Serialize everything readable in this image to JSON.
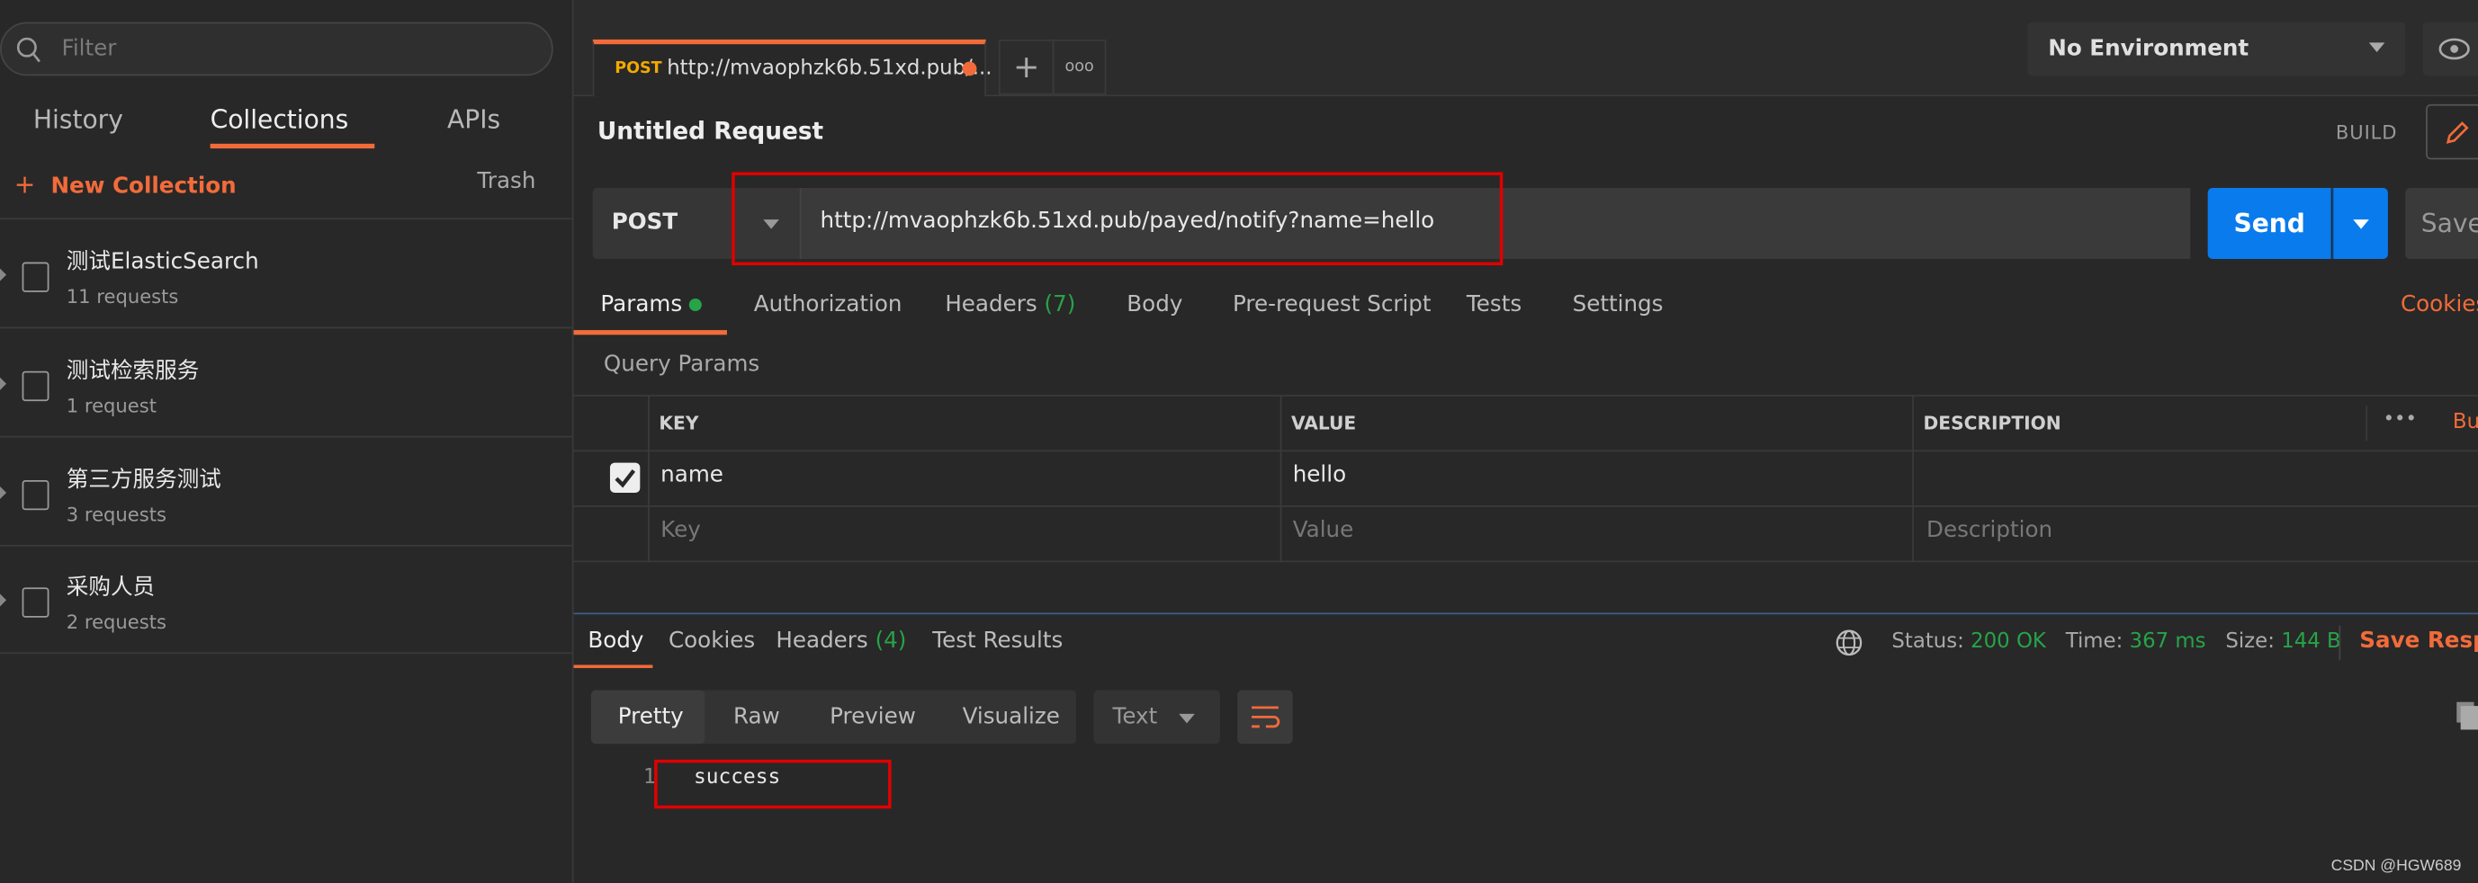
{
  "sidebar": {
    "filter_placeholder": "Filter",
    "tabs": [
      {
        "label": "History"
      },
      {
        "label": "Collections",
        "active": true
      },
      {
        "label": "APIs"
      }
    ],
    "new_collection": "New Collection",
    "trash": "Trash",
    "collections": [
      {
        "name": "测试ElasticSearch",
        "count": "11 requests"
      },
      {
        "name": "测试检索服务",
        "count": "1 request"
      },
      {
        "name": "第三方服务测试",
        "count": "3 requests"
      },
      {
        "name": "采购人员",
        "count": "2 requests"
      }
    ]
  },
  "request_tab": {
    "method": "POST",
    "title": "http://mvaophzk6b.51xd.pub/...",
    "plus": "+",
    "more": "ooo"
  },
  "environment": {
    "selected": "No Environment"
  },
  "request": {
    "title": "Untitled Request",
    "build": "BUILD",
    "method": "POST",
    "url": "http://mvaophzk6b.51xd.pub/payed/notify?name=hello",
    "send": "Send",
    "save": "Save"
  },
  "request_tabs": [
    {
      "label": "Params",
      "active": true
    },
    {
      "label": "Authorization"
    },
    {
      "label": "Headers",
      "count": "(7)"
    },
    {
      "label": "Body"
    },
    {
      "label": "Pre-request Script"
    },
    {
      "label": "Tests"
    },
    {
      "label": "Settings"
    }
  ],
  "cookies": "Cookies",
  "query_params": {
    "title": "Query Params",
    "headers": {
      "key": "KEY",
      "value": "VALUE",
      "description": "DESCRIPTION",
      "more": "•••",
      "bulk": "Bu"
    },
    "rows": [
      {
        "checked": true,
        "key": "name",
        "value": "hello",
        "description": ""
      }
    ],
    "placeholders": {
      "key": "Key",
      "value": "Value",
      "description": "Description"
    }
  },
  "response": {
    "tabs": [
      {
        "label": "Body",
        "active": true
      },
      {
        "label": "Cookies"
      },
      {
        "label": "Headers",
        "count": "(4)"
      },
      {
        "label": "Test Results"
      }
    ],
    "status_label": "Status:",
    "status": "200 OK",
    "time_label": "Time:",
    "time": "367 ms",
    "size_label": "Size:",
    "size": "144 B",
    "save_response": "Save Respo",
    "view_modes": [
      "Pretty",
      "Raw",
      "Preview",
      "Visualize"
    ],
    "format": "Text",
    "lines": [
      {
        "n": "1",
        "text": "success"
      }
    ]
  },
  "watermark": "CSDN @HGW689",
  "colors": {
    "accent": "#f26b3a",
    "send": "#097bed",
    "success": "#27a348",
    "highlight_box": "#e00000"
  }
}
